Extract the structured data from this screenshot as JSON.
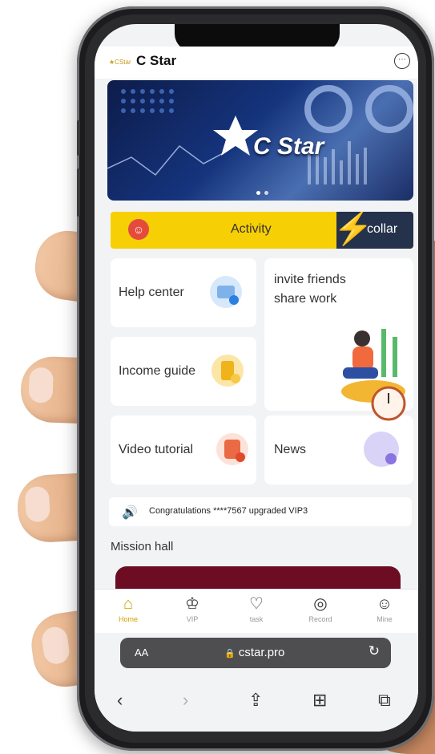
{
  "app": {
    "logo_text": "CStar",
    "title": "C Star",
    "chat_icon": "chat-bubble-icon"
  },
  "banner": {
    "text": "C Star",
    "slides": 2,
    "active_slide": 0
  },
  "activity": {
    "label": "Activity",
    "collar_label": "collar",
    "icon": "activity-badge-icon"
  },
  "cards": {
    "help_center": "Help center",
    "invite_line1": "invite friends",
    "invite_line2": "share work",
    "income_guide": "Income guide",
    "video_tutorial": "Video tutorial",
    "news": "News"
  },
  "notice": {
    "text": "Congratulations ****7567 upgraded VIP3"
  },
  "mission": {
    "title": "Mission hall"
  },
  "tabs": [
    {
      "label": "Home",
      "icon": "home-icon",
      "active": true
    },
    {
      "label": "VIP",
      "icon": "crown-icon",
      "active": false
    },
    {
      "label": "task",
      "icon": "task-icon",
      "active": false
    },
    {
      "label": "Record",
      "icon": "record-icon",
      "active": false
    },
    {
      "label": "Mine",
      "icon": "profile-icon",
      "active": false
    }
  ],
  "browser": {
    "aa_label": "AA",
    "url": "cstar.pro"
  },
  "colors": {
    "activity_yellow": "#f7cf05",
    "collar_navy": "#25324c",
    "mission_maroon": "#6d0d24",
    "active_tab": "#d0a000"
  }
}
